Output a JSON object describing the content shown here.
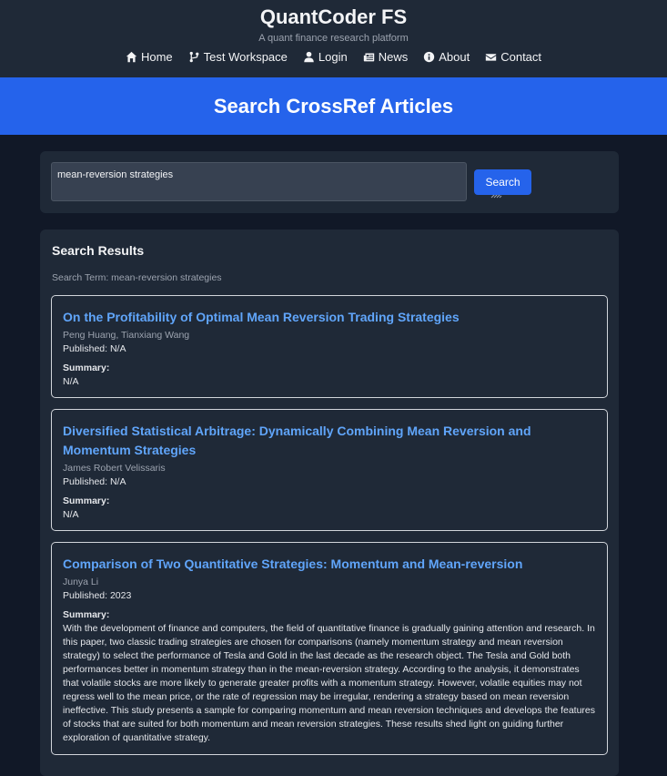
{
  "header": {
    "brand": "QuantCoder FS",
    "tagline": "A quant finance research platform",
    "nav": [
      {
        "label": "Home",
        "icon": "home-icon"
      },
      {
        "label": "Test Workspace",
        "icon": "code-branch-icon"
      },
      {
        "label": "Login",
        "icon": "user-icon"
      },
      {
        "label": "News",
        "icon": "newspaper-icon"
      },
      {
        "label": "About",
        "icon": "info-circle-icon"
      },
      {
        "label": "Contact",
        "icon": "envelope-icon"
      }
    ]
  },
  "hero": {
    "title": "Search CrossRef Articles"
  },
  "search": {
    "query": "mean-reversion strategies",
    "button_label": "Search"
  },
  "results": {
    "title": "Search Results",
    "term_line": "Search Term: mean-reversion strategies",
    "items": [
      {
        "title": "On the Profitability of Optimal Mean Reversion Trading Strategies",
        "authors": "Peng Huang, Tianxiang Wang",
        "published": "Published: N/A",
        "summary_label": "Summary:",
        "summary": "N/A"
      },
      {
        "title": "Diversified Statistical Arbitrage: Dynamically Combining Mean Reversion and Momentum Strategies",
        "authors": "James Robert Velissaris",
        "published": "Published: N/A",
        "summary_label": "Summary:",
        "summary": "N/A"
      },
      {
        "title": "Comparison of Two Quantitative Strategies: Momentum and Mean-reversion",
        "authors": "Junya Li",
        "published": "Published: 2023",
        "summary_label": "Summary:",
        "summary": "With the development of finance and computers, the field of quantitative finance is gradually gaining attention and research. In this paper, two classic trading strategies are chosen for comparisons (namely momentum strategy and mean reversion strategy) to select the performance of Tesla and Gold in the last decade as the research object. The Tesla and Gold both performances better in momentum strategy than in the mean-reversion strategy. According to the analysis, it demonstrates that volatile stocks are more likely to generate greater profits with a momentum strategy. However, volatile equities may not regress well to the mean price, or the rate of regression may be irregular, rendering a strategy based on mean reversion ineffective. This study presents a sample for comparing momentum and mean reversion techniques and develops the features of stocks that are suited for both momentum and mean reversion strategies. These results shed light on guiding further exploration of quantitative strategy."
      }
    ]
  },
  "colors": {
    "background": "#111827",
    "panel": "#1f2937",
    "accent": "#2563eb",
    "link": "#60a5fa"
  }
}
